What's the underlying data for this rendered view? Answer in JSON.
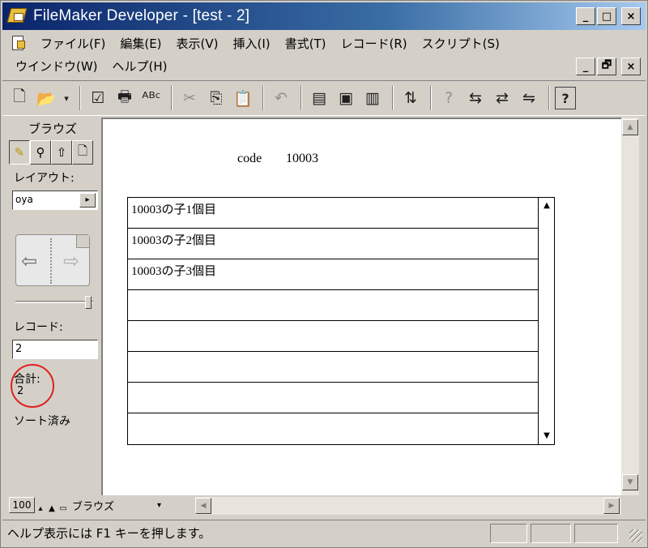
{
  "window": {
    "title": "FileMaker Developer - [test - 2]",
    "buttons": {
      "minimize": "_",
      "maximize": "□",
      "close": "×"
    }
  },
  "menu": {
    "row1": [
      "ファイル(F)",
      "編集(E)",
      "表示(V)",
      "挿入(I)",
      "書式(T)",
      "レコード(R)",
      "スクリプト(S)"
    ],
    "row2": [
      "ウインドウ(W)",
      "ヘルプ(H)"
    ],
    "mdi_buttons": {
      "minimize": "_",
      "restore": "🗗",
      "close": "×"
    }
  },
  "toolbar": {
    "icons": [
      "new-document-icon",
      "open-folder-icon",
      "check-icon",
      "print-icon",
      "spell-check-icon",
      "cut-icon",
      "copy-icon",
      "paste-icon",
      "undo-icon",
      "new-record-icon",
      "duplicate-record-icon",
      "delete-record-icon",
      "sort-icon",
      "find-icon",
      "replace-icon",
      "relookup-icon",
      "exchange-icon",
      "help-icon"
    ],
    "glyphs": {
      "new": "🗋",
      "open": "📂",
      "dropdown": "▾",
      "check": "☑",
      "print": "🖶",
      "spell": "ᴬᴮᶜ",
      "cut": "✂",
      "copy": "⎘",
      "paste": "📋",
      "undo": "↶",
      "newrec": "▤",
      "duprec": "▣",
      "delrec": "▥",
      "sort": "⇅",
      "find": "?",
      "replace": "⇆",
      "relookup": "⇄",
      "exchange": "⇋",
      "help": "?"
    }
  },
  "status": {
    "mode_title": "ブラウズ",
    "mode_tabs": [
      "✎",
      "⚲",
      "⇧",
      "🗋"
    ],
    "layout_label": "レイアウト:",
    "layout_value": "oya",
    "layout_arrow": "▸",
    "record_label": "レコード:",
    "record_value": "2",
    "total_label": "合計:",
    "total_value": "2",
    "sorted_label": "ソート済み",
    "book_left": "⇦",
    "book_right": "⇨",
    "zoom_value": "100",
    "zoom_small": "▴",
    "zoom_large": "▲",
    "mode_select": "ブラウズ",
    "mode_select_arrow": "▾"
  },
  "content": {
    "code_label": "code",
    "code_value": "10003",
    "portal_rows": [
      "10003の子1個目",
      "10003の子2個目",
      "10003の子3個目",
      "",
      "",
      "",
      "",
      ""
    ],
    "scroll_up": "▲",
    "scroll_down": "▼"
  },
  "scrollbars": {
    "up": "▲",
    "down": "▼",
    "left": "◀",
    "right": "▶"
  },
  "statusbar": {
    "help_text": "ヘルプ表示には F1 キーを押します。"
  }
}
